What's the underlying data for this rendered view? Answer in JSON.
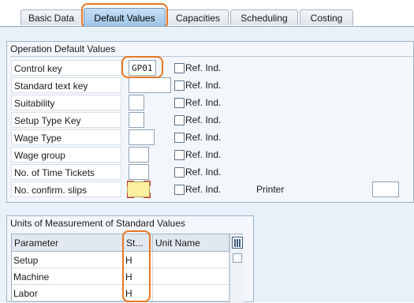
{
  "tabs": [
    {
      "label": "Basic Data"
    },
    {
      "label": "Default Values"
    },
    {
      "label": "Capacities"
    },
    {
      "label": "Scheduling"
    },
    {
      "label": "Costing"
    }
  ],
  "operation_defaults": {
    "title": "Operation Default Values",
    "rows": [
      {
        "label": "Control key",
        "value": "GP01",
        "ref_ind": "Ref. Ind."
      },
      {
        "label": "Standard text key",
        "value": "",
        "ref_ind": "Ref. Ind."
      },
      {
        "label": "Suitability",
        "value": "",
        "ref_ind": "Ref. Ind."
      },
      {
        "label": "Setup Type Key",
        "value": "",
        "ref_ind": "Ref. Ind."
      },
      {
        "label": "Wage Type",
        "value": "",
        "ref_ind": "Ref. Ind."
      },
      {
        "label": "Wage group",
        "value": "",
        "ref_ind": "Ref. Ind."
      },
      {
        "label": "No. of Time Tickets",
        "value": "",
        "ref_ind": "Ref. Ind."
      },
      {
        "label": "No. confirm. slips",
        "value": "",
        "ref_ind": "Ref. Ind."
      }
    ],
    "printer_label": "Printer",
    "printer_value": ""
  },
  "units": {
    "title": "Units of Measurement of Standard Values",
    "columns": [
      "Parameter",
      "St...",
      "Unit Name"
    ],
    "rows": [
      {
        "parameter": "Setup",
        "std": "H",
        "unit_name": ""
      },
      {
        "parameter": "Machine",
        "std": "H",
        "unit_name": ""
      },
      {
        "parameter": "Labor",
        "std": "H",
        "unit_name": ""
      }
    ]
  },
  "colors": {
    "highlight": "#e87722",
    "required_field": "#fdf0a0",
    "active_tab": "#9cc3e6"
  }
}
